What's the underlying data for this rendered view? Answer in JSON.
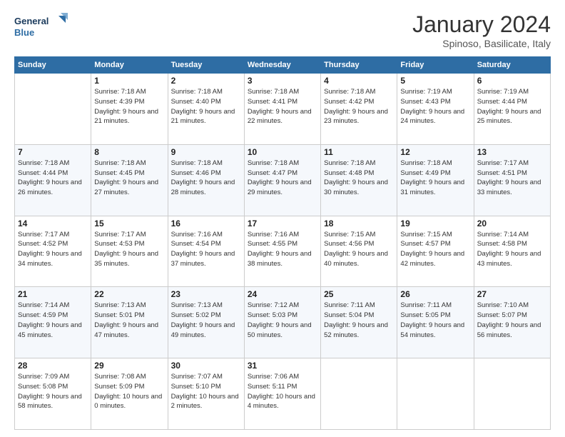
{
  "header": {
    "logo": {
      "line1": "General",
      "line2": "Blue"
    },
    "title": "January 2024",
    "location": "Spinoso, Basilicate, Italy"
  },
  "weekdays": [
    "Sunday",
    "Monday",
    "Tuesday",
    "Wednesday",
    "Thursday",
    "Friday",
    "Saturday"
  ],
  "weeks": [
    [
      {
        "day": "",
        "sunrise": "",
        "sunset": "",
        "daylight": ""
      },
      {
        "day": "1",
        "sunrise": "Sunrise: 7:18 AM",
        "sunset": "Sunset: 4:39 PM",
        "daylight": "Daylight: 9 hours and 21 minutes."
      },
      {
        "day": "2",
        "sunrise": "Sunrise: 7:18 AM",
        "sunset": "Sunset: 4:40 PM",
        "daylight": "Daylight: 9 hours and 21 minutes."
      },
      {
        "day": "3",
        "sunrise": "Sunrise: 7:18 AM",
        "sunset": "Sunset: 4:41 PM",
        "daylight": "Daylight: 9 hours and 22 minutes."
      },
      {
        "day": "4",
        "sunrise": "Sunrise: 7:18 AM",
        "sunset": "Sunset: 4:42 PM",
        "daylight": "Daylight: 9 hours and 23 minutes."
      },
      {
        "day": "5",
        "sunrise": "Sunrise: 7:19 AM",
        "sunset": "Sunset: 4:43 PM",
        "daylight": "Daylight: 9 hours and 24 minutes."
      },
      {
        "day": "6",
        "sunrise": "Sunrise: 7:19 AM",
        "sunset": "Sunset: 4:44 PM",
        "daylight": "Daylight: 9 hours and 25 minutes."
      }
    ],
    [
      {
        "day": "7",
        "sunrise": "Sunrise: 7:18 AM",
        "sunset": "Sunset: 4:44 PM",
        "daylight": "Daylight: 9 hours and 26 minutes."
      },
      {
        "day": "8",
        "sunrise": "Sunrise: 7:18 AM",
        "sunset": "Sunset: 4:45 PM",
        "daylight": "Daylight: 9 hours and 27 minutes."
      },
      {
        "day": "9",
        "sunrise": "Sunrise: 7:18 AM",
        "sunset": "Sunset: 4:46 PM",
        "daylight": "Daylight: 9 hours and 28 minutes."
      },
      {
        "day": "10",
        "sunrise": "Sunrise: 7:18 AM",
        "sunset": "Sunset: 4:47 PM",
        "daylight": "Daylight: 9 hours and 29 minutes."
      },
      {
        "day": "11",
        "sunrise": "Sunrise: 7:18 AM",
        "sunset": "Sunset: 4:48 PM",
        "daylight": "Daylight: 9 hours and 30 minutes."
      },
      {
        "day": "12",
        "sunrise": "Sunrise: 7:18 AM",
        "sunset": "Sunset: 4:49 PM",
        "daylight": "Daylight: 9 hours and 31 minutes."
      },
      {
        "day": "13",
        "sunrise": "Sunrise: 7:17 AM",
        "sunset": "Sunset: 4:51 PM",
        "daylight": "Daylight: 9 hours and 33 minutes."
      }
    ],
    [
      {
        "day": "14",
        "sunrise": "Sunrise: 7:17 AM",
        "sunset": "Sunset: 4:52 PM",
        "daylight": "Daylight: 9 hours and 34 minutes."
      },
      {
        "day": "15",
        "sunrise": "Sunrise: 7:17 AM",
        "sunset": "Sunset: 4:53 PM",
        "daylight": "Daylight: 9 hours and 35 minutes."
      },
      {
        "day": "16",
        "sunrise": "Sunrise: 7:16 AM",
        "sunset": "Sunset: 4:54 PM",
        "daylight": "Daylight: 9 hours and 37 minutes."
      },
      {
        "day": "17",
        "sunrise": "Sunrise: 7:16 AM",
        "sunset": "Sunset: 4:55 PM",
        "daylight": "Daylight: 9 hours and 38 minutes."
      },
      {
        "day": "18",
        "sunrise": "Sunrise: 7:15 AM",
        "sunset": "Sunset: 4:56 PM",
        "daylight": "Daylight: 9 hours and 40 minutes."
      },
      {
        "day": "19",
        "sunrise": "Sunrise: 7:15 AM",
        "sunset": "Sunset: 4:57 PM",
        "daylight": "Daylight: 9 hours and 42 minutes."
      },
      {
        "day": "20",
        "sunrise": "Sunrise: 7:14 AM",
        "sunset": "Sunset: 4:58 PM",
        "daylight": "Daylight: 9 hours and 43 minutes."
      }
    ],
    [
      {
        "day": "21",
        "sunrise": "Sunrise: 7:14 AM",
        "sunset": "Sunset: 4:59 PM",
        "daylight": "Daylight: 9 hours and 45 minutes."
      },
      {
        "day": "22",
        "sunrise": "Sunrise: 7:13 AM",
        "sunset": "Sunset: 5:01 PM",
        "daylight": "Daylight: 9 hours and 47 minutes."
      },
      {
        "day": "23",
        "sunrise": "Sunrise: 7:13 AM",
        "sunset": "Sunset: 5:02 PM",
        "daylight": "Daylight: 9 hours and 49 minutes."
      },
      {
        "day": "24",
        "sunrise": "Sunrise: 7:12 AM",
        "sunset": "Sunset: 5:03 PM",
        "daylight": "Daylight: 9 hours and 50 minutes."
      },
      {
        "day": "25",
        "sunrise": "Sunrise: 7:11 AM",
        "sunset": "Sunset: 5:04 PM",
        "daylight": "Daylight: 9 hours and 52 minutes."
      },
      {
        "day": "26",
        "sunrise": "Sunrise: 7:11 AM",
        "sunset": "Sunset: 5:05 PM",
        "daylight": "Daylight: 9 hours and 54 minutes."
      },
      {
        "day": "27",
        "sunrise": "Sunrise: 7:10 AM",
        "sunset": "Sunset: 5:07 PM",
        "daylight": "Daylight: 9 hours and 56 minutes."
      }
    ],
    [
      {
        "day": "28",
        "sunrise": "Sunrise: 7:09 AM",
        "sunset": "Sunset: 5:08 PM",
        "daylight": "Daylight: 9 hours and 58 minutes."
      },
      {
        "day": "29",
        "sunrise": "Sunrise: 7:08 AM",
        "sunset": "Sunset: 5:09 PM",
        "daylight": "Daylight: 10 hours and 0 minutes."
      },
      {
        "day": "30",
        "sunrise": "Sunrise: 7:07 AM",
        "sunset": "Sunset: 5:10 PM",
        "daylight": "Daylight: 10 hours and 2 minutes."
      },
      {
        "day": "31",
        "sunrise": "Sunrise: 7:06 AM",
        "sunset": "Sunset: 5:11 PM",
        "daylight": "Daylight: 10 hours and 4 minutes."
      },
      {
        "day": "",
        "sunrise": "",
        "sunset": "",
        "daylight": ""
      },
      {
        "day": "",
        "sunrise": "",
        "sunset": "",
        "daylight": ""
      },
      {
        "day": "",
        "sunrise": "",
        "sunset": "",
        "daylight": ""
      }
    ]
  ]
}
